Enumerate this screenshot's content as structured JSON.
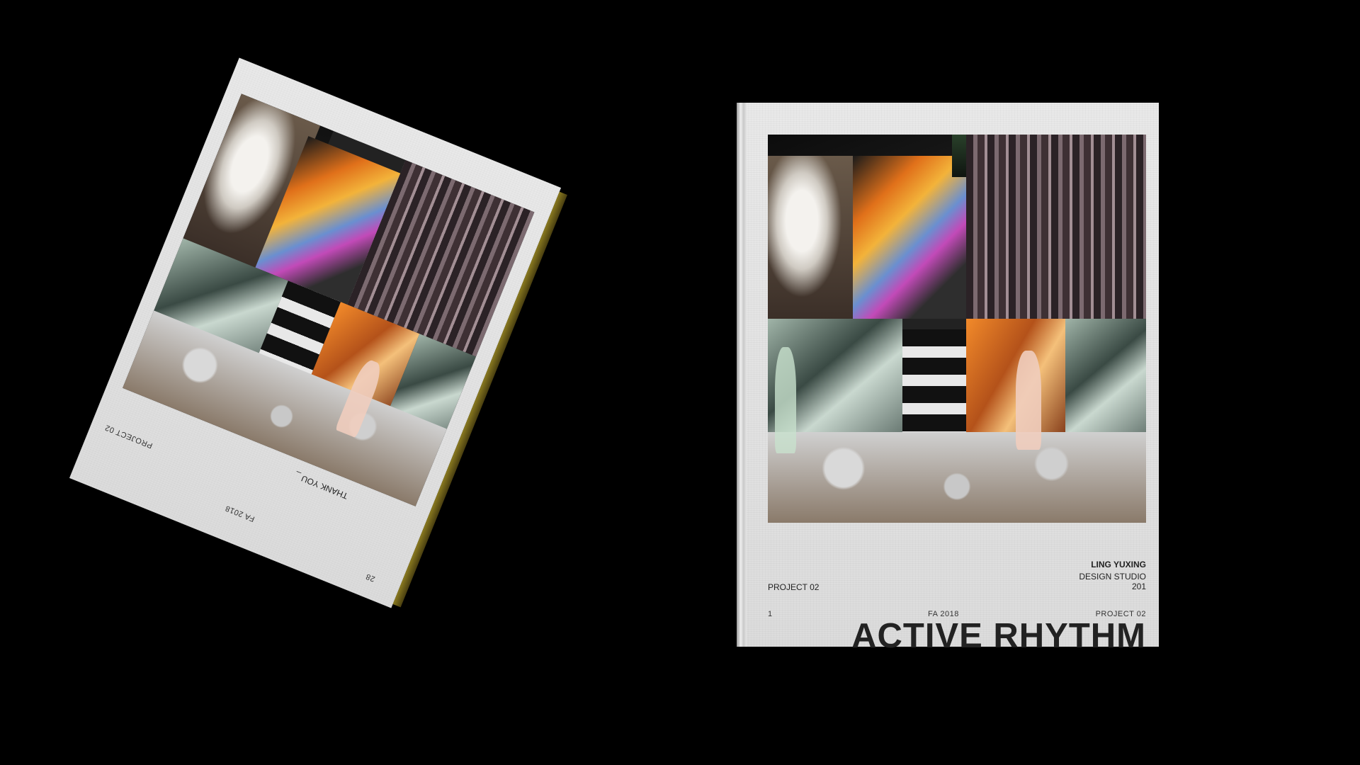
{
  "front_cover": {
    "title": "ACTIVE RHYTHM",
    "author": "LING YUXING",
    "course_line1": "DESIGN STUDIO",
    "course_line2": "201",
    "project_label": "PROJECT 02",
    "footer_page": "1",
    "footer_term": "FA 2018",
    "footer_project": "PROJECT 02"
  },
  "back_cover": {
    "thank_you": "THANK YOU _",
    "project_label": "PROJECT 02",
    "term": "FA 2018",
    "page": "28"
  },
  "colors": {
    "background": "#000000",
    "cover": "#e3e3e3",
    "text": "#222222",
    "back_spine": "#7a6a1a"
  }
}
